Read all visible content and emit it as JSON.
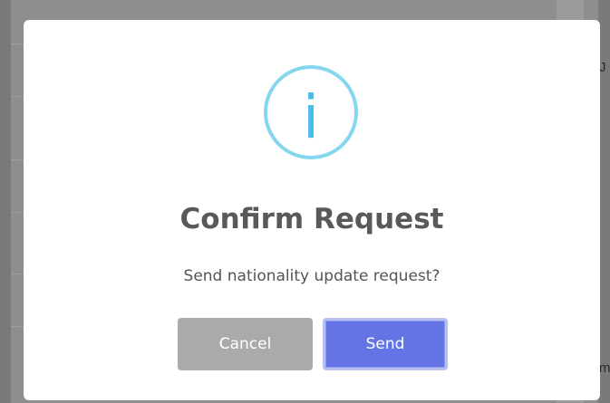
{
  "dialog": {
    "icon": "info-icon",
    "icon_glyph": "i",
    "title": "Confirm Request",
    "text": "Send nationality update request?",
    "cancel_label": "Cancel",
    "confirm_label": "Send"
  },
  "background": {
    "edge_text_top": "J",
    "edge_text_bottom": "m"
  },
  "colors": {
    "icon": "#87d6f0",
    "icon_glyph": "#49bcec",
    "cancel_button": "#aaaaaa",
    "confirm_button": "#6474e5"
  }
}
